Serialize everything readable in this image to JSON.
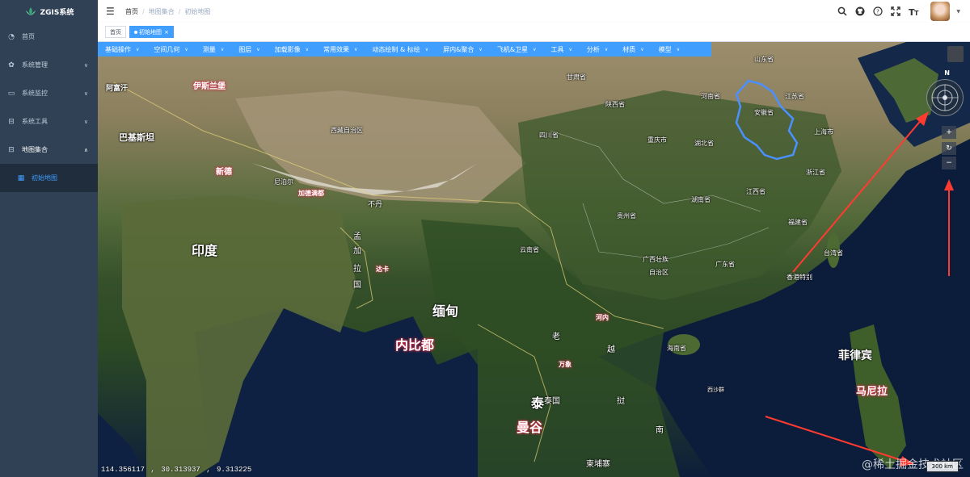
{
  "app": {
    "title": "ZGIS系统"
  },
  "sidebar": {
    "items": [
      {
        "label": "首页",
        "icon": "dashboard-icon"
      },
      {
        "label": "系统管理",
        "icon": "gear-icon"
      },
      {
        "label": "系统监控",
        "icon": "monitor-icon"
      },
      {
        "label": "系统工具",
        "icon": "toolbox-icon"
      },
      {
        "label": "地图集合",
        "icon": "map-collection-icon",
        "expanded": true
      }
    ],
    "sub_items": [
      {
        "label": "初始地图",
        "active": true
      }
    ]
  },
  "header": {
    "breadcrumb": [
      "首页",
      "地图集合",
      "初始地图"
    ],
    "icons": [
      "search-icon",
      "github-icon",
      "help-icon",
      "fullscreen-icon",
      "font-size-icon"
    ]
  },
  "tags": [
    {
      "label": "首页",
      "active": false
    },
    {
      "label": "初始地图",
      "active": true
    }
  ],
  "toolbar": {
    "items": [
      "基础操作",
      "空间几何",
      "测量",
      "图层",
      "加载影像",
      "常用效果",
      "动态绘制 & 标绘",
      "屏内&聚合",
      "飞机&卫星",
      "工具",
      "分析",
      "材质",
      "模型"
    ]
  },
  "map": {
    "labels": {
      "afghanistan": "阿富汗",
      "islamabad": "伊斯兰堡",
      "pakistan": "巴基斯坦",
      "delhi": "新德",
      "india": "印度",
      "nepal": "尼泊尔",
      "kathmandu": "加德满都",
      "bhutan": "不丹",
      "bangladesh_chars": [
        "孟",
        "加",
        "拉",
        "国"
      ],
      "dhaka": "达卡",
      "myanmar": "缅甸",
      "naypyidaw": "内比都",
      "tibet": "西藏自治区",
      "gansu": "甘肃省",
      "shaanxi": "陕西省",
      "sichuan": "四川省",
      "chongqing": "重庆市",
      "henan": "河南省",
      "hubei": "湖北省",
      "anhui": "安徽省",
      "jiangsu": "江苏省",
      "shanghai": "上海市",
      "zhejiang": "浙江省",
      "shandong": "山东省",
      "yunnan": "云南省",
      "guizhou": "贵州省",
      "hunan": "湖南省",
      "jiangxi": "江西省",
      "fujian": "福建省",
      "guangxi_1": "广西壮族",
      "guangxi_2": "自治区",
      "guangdong": "广东省",
      "taiwan": "台湾省",
      "hongkong": "香港特别",
      "hainan": "海南省",
      "xisha": "西沙群",
      "hanoi": "河内",
      "laos": "老",
      "vientiane": "万象",
      "vietnam_chars": [
        "越",
        "南"
      ],
      "thailand": "泰国",
      "thai_char": "泰",
      "bangkok": "曼谷",
      "cambodia": "柬埔寨",
      "philippines": "菲律宾",
      "manila": "马尼拉",
      "laos2": "挝"
    },
    "compass_north": "N",
    "zoom_in": "+",
    "zoom_reset": "↻",
    "zoom_out": "−",
    "coordinates": "114.356117 ,  30.313937 ,  9.313225",
    "scale_label": "300 km",
    "watermark": "@稀土掘金技术社区"
  },
  "colors": {
    "sidebar_bg": "#304156",
    "toolbar_bg": "#409eff",
    "active_tag": "#409eff",
    "anhui_outline": "#4a90ff",
    "annotation_arrow": "#ff3b30"
  }
}
